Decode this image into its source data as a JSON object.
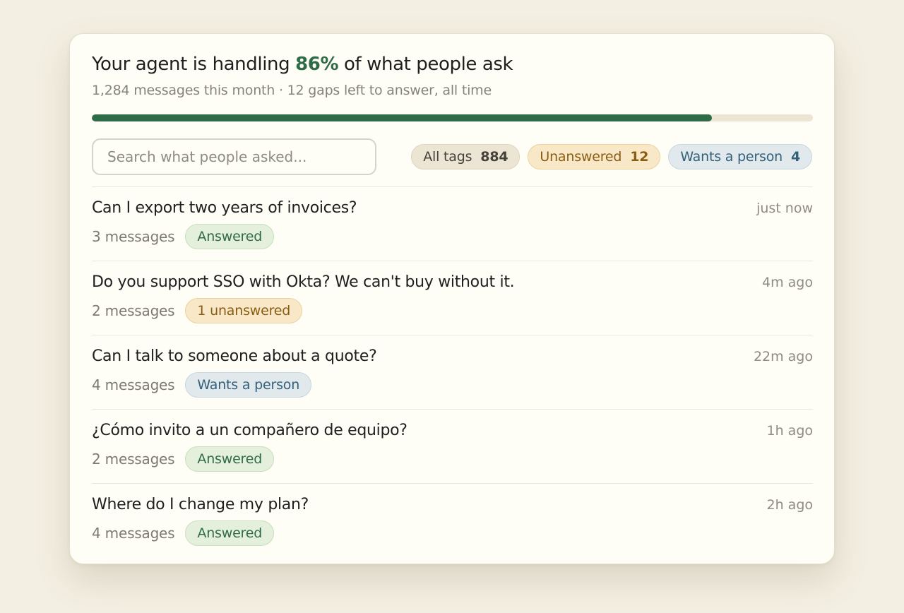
{
  "summary": {
    "headline_prefix": "Your agent is handling",
    "headline_percent": "86%",
    "headline_suffix": "of what people ask",
    "subline": "1,284 messages this month · 12 gaps left to answer, all time",
    "progress_fraction": 0.86,
    "accent_color": "#2f6b46"
  },
  "search": {
    "placeholder": "Search what people asked...",
    "icon": "none"
  },
  "filters": [
    {
      "label": "All tags",
      "count": "884",
      "style": "neutral"
    },
    {
      "label": "Unanswered",
      "count": "12",
      "style": "amber"
    },
    {
      "label": "Wants a person",
      "count": "4",
      "style": "blue"
    }
  ],
  "conversations": [
    {
      "question": "Can I export two years of invoices?",
      "message_count": "3 messages",
      "status": "Answered",
      "status_type": "answered",
      "time": "just now"
    },
    {
      "question": "Do you support SSO with Okta? We can't buy without it.",
      "message_count": "2 messages",
      "status": "1 unanswered",
      "status_type": "unanswered",
      "time": "4m ago"
    },
    {
      "question": "Can I talk to someone about a quote?",
      "message_count": "4 messages",
      "status": "Wants a person",
      "status_type": "person",
      "time": "22m ago"
    },
    {
      "question": "¿Cómo invito a un compañero de equipo?",
      "message_count": "2 messages",
      "status": "Answered",
      "status_type": "answered",
      "time": "1h ago"
    },
    {
      "question": "Where do I change my plan?",
      "message_count": "4 messages",
      "status": "Answered",
      "status_type": "answered",
      "time": "2h ago"
    }
  ]
}
